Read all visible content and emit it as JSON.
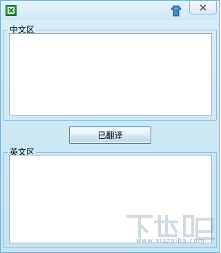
{
  "titlebar": {
    "app_icon": "excel-icon",
    "skin_icon": "shirt-icon",
    "close_icon": "close-icon"
  },
  "chinese_group": {
    "label": "中文区",
    "text_value": ""
  },
  "translate_button": {
    "label": "已翻译"
  },
  "english_group": {
    "label": "英文区",
    "text_value": ""
  },
  "watermark": {
    "logo": "下载吧",
    "url": "www.xiazaiba.com"
  },
  "colors": {
    "window_bg": "#cce7f5",
    "border": "#8fbfd6",
    "button_border": "#3c7fb1"
  }
}
